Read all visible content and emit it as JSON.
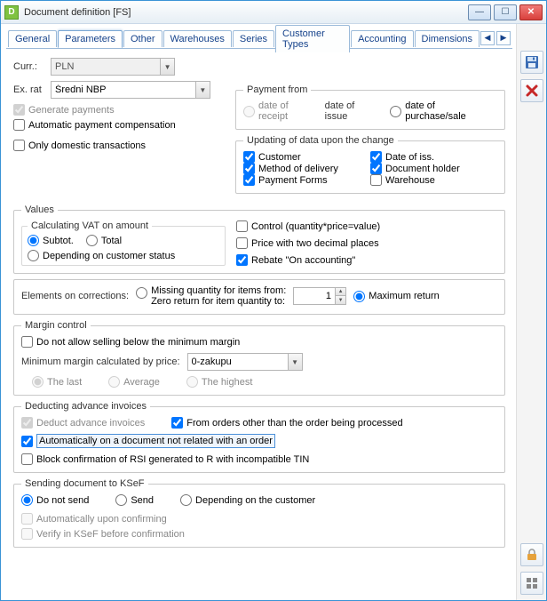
{
  "window": {
    "title": "Document definition [FS]"
  },
  "tabs": {
    "items": [
      "General",
      "Parameters",
      "Other",
      "Warehouses",
      "Series",
      "Customer Types",
      "Accounting",
      "Dimensions"
    ],
    "active": 1
  },
  "curr": {
    "label": "Curr.:",
    "value": "PLN"
  },
  "exrate": {
    "label": "Ex. rat",
    "value": "Średni NBP"
  },
  "gen_payments": "Generate payments",
  "auto_pay_comp": "Automatic payment compensation",
  "only_domestic": "Only domestic transactions",
  "payment_from": {
    "legend": "Payment from",
    "opt1": "date of receipt",
    "opt2": "date of issue",
    "opt3": "date of purchase/sale"
  },
  "updating": {
    "legend": "Updating of data upon the change",
    "c1": "Customer",
    "c2": "Method of delivery",
    "c3": "Payment Forms",
    "c4": "Date of iss.",
    "c5": "Document holder",
    "c6": "Warehouse"
  },
  "values": {
    "legend": "Values",
    "calc_label": "Calculating VAT on amount",
    "subtot": "Subtot.",
    "total": "Total",
    "depending": "Depending on customer status",
    "control": "Control (quantity*price=value)",
    "twodec": "Price with two decimal places",
    "rebate": "Rebate \"On accounting\""
  },
  "corrections": {
    "label": "Elements on corrections:",
    "missing1": "Missing quantity for items from:",
    "missing2": "Zero return for item quantity to:",
    "spinner": "1",
    "maxreturn": "Maximum return"
  },
  "margin": {
    "legend": "Margin control",
    "dont_allow": "Do not allow selling below the minimum margin",
    "min_label": "Minimum margin calculated by price:",
    "combo": "0-zakupu",
    "last": "The last",
    "avg": "Average",
    "highest": "The highest"
  },
  "advance": {
    "legend": "Deducting advance invoices",
    "deduct": "Deduct advance invoices",
    "fromorders": "From orders other than the order being processed",
    "auto_doc": "Automatically on a document not related with an order",
    "block_rsi": "Block confirmation of RSI generated to R with incompatible TIN"
  },
  "ksef": {
    "legend": "Sending document to KSeF",
    "nosend": "Do not send",
    "send": "Send",
    "depending": "Depending on the customer",
    "auto_confirm": "Automatically upon confirming",
    "verify": "Verify in KSeF before confirmation"
  }
}
